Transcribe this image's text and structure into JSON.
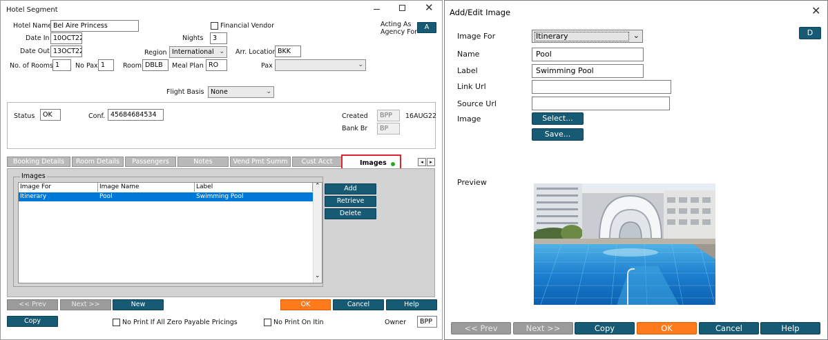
{
  "hotel": {
    "title": "Hotel Segment",
    "hotel_name_label": "Hotel Name",
    "hotel_name": "Bel Aire Princess",
    "financial_vendor": "Financial Vendor",
    "acting_as": "Acting As",
    "agency_for": "Agency For",
    "a_btn": "A",
    "date_in_label": "Date In",
    "date_in": "10OCT22",
    "nights_label": "Nights",
    "nights": "3",
    "date_out_label": "Date Out",
    "date_out": "13OCT22",
    "region_label": "Region",
    "region": "International",
    "arr_loc_label": "Arr. Location",
    "arr_loc": "BKK",
    "rooms_label": "No. of Rooms",
    "rooms": "1",
    "pax_count_label": "No Pax",
    "pax_count": "1",
    "room_label": "Room",
    "room": "DBLB",
    "meal_label": "Meal Plan",
    "meal": "RO",
    "pax_label": "Pax",
    "pax": "",
    "flight_label": "Flight Basis",
    "flight": "None",
    "status_label": "Status",
    "status": "OK",
    "conf_label": "Conf.",
    "conf": "45684684534",
    "created_label": "Created",
    "created_code": "BPP",
    "created_date": "16AUG22",
    "bank_label": "Bank Br",
    "bank": "BP",
    "tabs": [
      "Booking Details",
      "Room Details",
      "Passengers",
      "Notes",
      "Vend Pmt Summ",
      "Cust Acct Data",
      "Images"
    ],
    "images_group": "Images",
    "cols": [
      "Image For",
      "Image Name",
      "Label"
    ],
    "row": [
      "Itinerary",
      "Pool",
      "Swimming Pool"
    ],
    "add": "Add",
    "retrieve": "Retrieve",
    "delete": "Delete",
    "prev": "<< Prev",
    "next": "Next >>",
    "new": "New",
    "ok": "OK",
    "cancel": "Cancel",
    "help": "Help",
    "copy": "Copy",
    "no_print_zero": "No Print If All Zero Payable Pricings",
    "no_print_itin": "No Print On Itin",
    "owner_label": "Owner",
    "owner": "BPP"
  },
  "dialog": {
    "title": "Add/Edit Image",
    "d_btn": "D",
    "image_for_label": "Image For",
    "image_for": "Itinerary",
    "name_label": "Name",
    "name": "Pool",
    "label_label": "Label",
    "label": "Swimming Pool",
    "link_label": "Link Url",
    "link": "",
    "source_label": "Source Url",
    "source": "",
    "image_label": "Image",
    "select": "Select...",
    "save": "Save...",
    "preview": "Preview",
    "prev": "<< Prev",
    "next": "Next >>",
    "copy": "Copy",
    "ok": "OK",
    "cancel": "Cancel",
    "help": "Help"
  },
  "colors": {
    "teal": "#175a74",
    "orange": "#ff7a1a",
    "highlight": "#e0242f",
    "selection": "#0078d7"
  }
}
